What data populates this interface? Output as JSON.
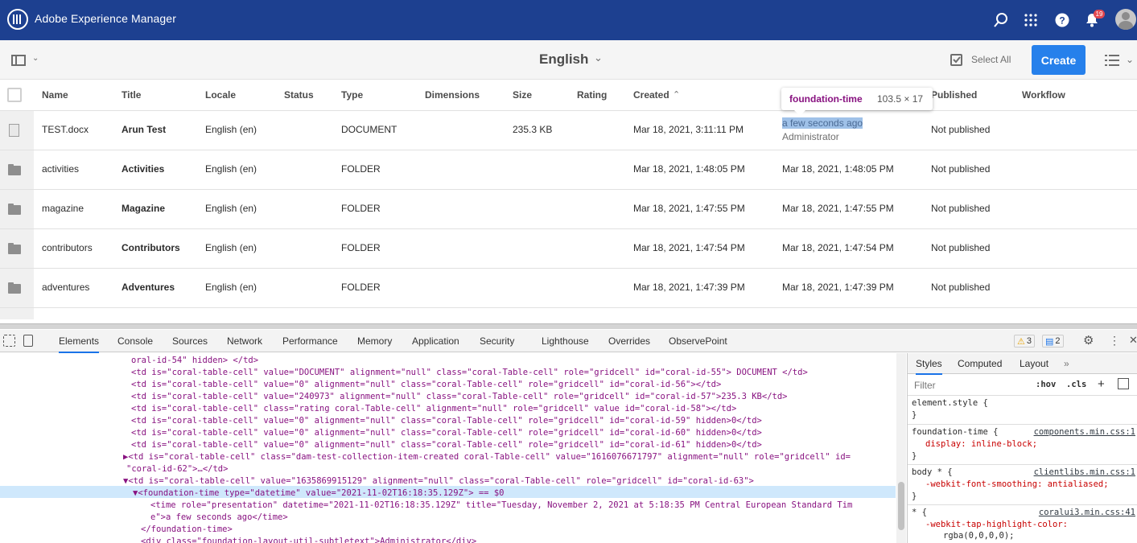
{
  "shell": {
    "app_title": "Adobe Experience Manager",
    "notification_count": "19"
  },
  "actionbar": {
    "locale_title": "English",
    "select_all": "Select All",
    "create": "Create"
  },
  "table": {
    "headers": [
      "Name",
      "Title",
      "Locale",
      "Status",
      "Type",
      "Dimensions",
      "Size",
      "Rating",
      "Created",
      "Published",
      "Workflow"
    ],
    "rows": [
      {
        "name": "TEST.docx",
        "title": "Arun Test",
        "locale": "English (en)",
        "type": "DOCUMENT",
        "size": "235.3 KB",
        "created": "Mar 18, 2021, 3:11:11 PM",
        "modified": "a few seconds ago",
        "modified_by": "Administrator",
        "published": "Not published"
      },
      {
        "name": "activities",
        "title": "Activities",
        "locale": "English (en)",
        "type": "FOLDER",
        "size": "",
        "created": "Mar 18, 2021, 1:48:05 PM",
        "modified": "Mar 18, 2021, 1:48:05 PM",
        "modified_by": "",
        "published": "Not published"
      },
      {
        "name": "magazine",
        "title": "Magazine",
        "locale": "English (en)",
        "type": "FOLDER",
        "size": "",
        "created": "Mar 18, 2021, 1:47:55 PM",
        "modified": "Mar 18, 2021, 1:47:55 PM",
        "modified_by": "",
        "published": "Not published"
      },
      {
        "name": "contributors",
        "title": "Contributors",
        "locale": "English (en)",
        "type": "FOLDER",
        "size": "",
        "created": "Mar 18, 2021, 1:47:54 PM",
        "modified": "Mar 18, 2021, 1:47:54 PM",
        "modified_by": "",
        "published": "Not published"
      },
      {
        "name": "adventures",
        "title": "Adventures",
        "locale": "English (en)",
        "type": "FOLDER",
        "size": "",
        "created": "Mar 18, 2021, 1:47:39 PM",
        "modified": "Mar 18, 2021, 1:47:39 PM",
        "modified_by": "",
        "published": "Not published"
      }
    ]
  },
  "tooltip": {
    "tag": "foundation-time",
    "dimensions": "103.5 × 17"
  },
  "devtools": {
    "tabs": [
      "Elements",
      "Console",
      "Sources",
      "Network",
      "Performance",
      "Memory",
      "Application",
      "Security",
      "Lighthouse",
      "Overrides",
      "ObservePoint"
    ],
    "warnings": "3",
    "messages": "2",
    "code_lines": [
      "oral-id-54\" hidden> </td>",
      "<td is=\"coral-table-cell\" value=\"DOCUMENT\" alignment=\"null\" class=\"coral-Table-cell\" role=\"gridcell\" id=\"coral-id-55\"> DOCUMENT </td>",
      "<td is=\"coral-table-cell\" value=\"0\" alignment=\"null\" class=\"coral-Table-cell\" role=\"gridcell\" id=\"coral-id-56\"></td>",
      "<td is=\"coral-table-cell\" value=\"240973\" alignment=\"null\" class=\"coral-Table-cell\" role=\"gridcell\" id=\"coral-id-57\">235.3 KB</td>",
      "<td is=\"coral-table-cell\" class=\"rating coral-Table-cell\" alignment=\"null\" role=\"gridcell\" value id=\"coral-id-58\"></td>",
      "<td is=\"coral-table-cell\" value=\"0\" alignment=\"null\" class=\"coral-Table-cell\" role=\"gridcell\" id=\"coral-id-59\" hidden>0</td>",
      "<td is=\"coral-table-cell\" value=\"0\" alignment=\"null\" class=\"coral-Table-cell\" role=\"gridcell\" id=\"coral-id-60\" hidden>0</td>",
      "<td is=\"coral-table-cell\" value=\"0\" alignment=\"null\" class=\"coral-Table-cell\" role=\"gridcell\" id=\"coral-id-61\" hidden>0</td>",
      "▶<td is=\"coral-table-cell\" class=\"dam-test-collection-item-created coral-Table-cell\" value=\"1616076671797\" alignment=\"null\" role=\"gridcell\" id=",
      "\"coral-id-62\">…</td>",
      "▼<td is=\"coral-table-cell\" value=\"1635869915129\" alignment=\"null\" class=\"coral-Table-cell\" role=\"gridcell\" id=\"coral-id-63\">",
      "▼<foundation-time type=\"datetime\" value=\"2021-11-02T16:18:35.129Z\"> == $0",
      "<time role=\"presentation\" datetime=\"2021-11-02T16:18:35.129Z\" title=\"Tuesday, November 2, 2021 at 5:18:35 PM Central European Standard Tim",
      "e\">a few seconds ago</time>",
      "</foundation-time>",
      "<div class=\"foundation-layout-util-subtletext\">Administrator</div>"
    ],
    "styles_tabs": [
      "Styles",
      "Computed",
      "Layout"
    ],
    "filter_placeholder": "Filter",
    "hov": ":hov",
    "cls": ".cls",
    "rules": [
      {
        "selector": "element.style {",
        "decl": "",
        "close": "}",
        "source": ""
      },
      {
        "selector": "foundation-time {",
        "decl": "display: inline-block;",
        "close": "}",
        "source": "components.min.css:1"
      },
      {
        "selector": "body * {",
        "decl": "-webkit-font-smoothing: antialiased;",
        "close": "}",
        "source": "clientlibs.min.css:1"
      },
      {
        "selector": "* {",
        "decl": "-webkit-tap-highlight-color:",
        "close": "rgba(0,0,0,0);",
        "source": "coralui3.min.css:41"
      }
    ]
  }
}
